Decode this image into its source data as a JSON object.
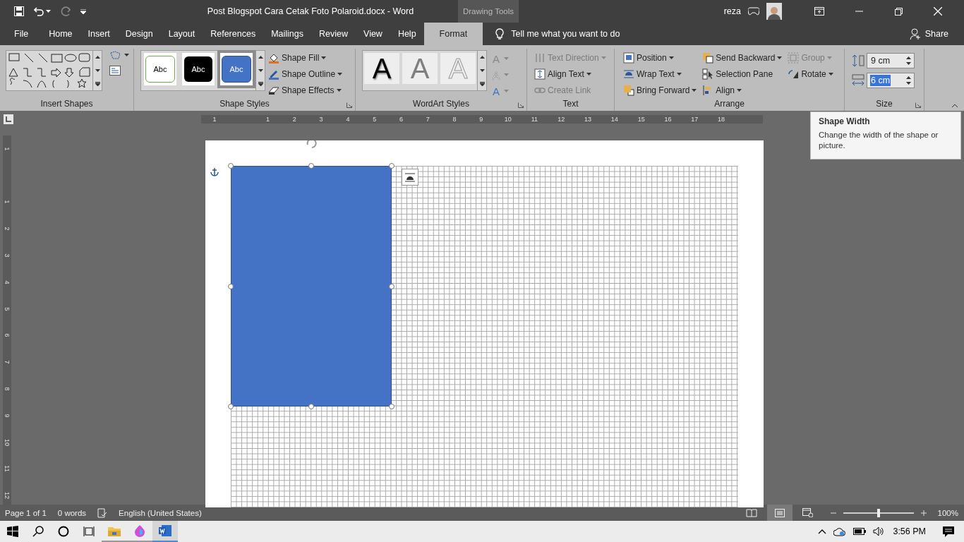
{
  "title_bar": {
    "title": "Post Blogspot Cara Cetak Foto Polaroid.docx  -  Word",
    "context_label": "Drawing Tools",
    "user": "reza",
    "redo_disabled": true
  },
  "tabs": [
    {
      "label": "File",
      "selected": false
    },
    {
      "label": "Home",
      "selected": false
    },
    {
      "label": "Insert",
      "selected": false
    },
    {
      "label": "Design",
      "selected": false
    },
    {
      "label": "Layout",
      "selected": false
    },
    {
      "label": "References",
      "selected": false
    },
    {
      "label": "Mailings",
      "selected": false
    },
    {
      "label": "Review",
      "selected": false
    },
    {
      "label": "View",
      "selected": false
    },
    {
      "label": "Help",
      "selected": false
    },
    {
      "label": "Format",
      "selected": true
    }
  ],
  "tell_me": "Tell me what you want to do",
  "share": "Share",
  "ribbon": {
    "insert_shapes": {
      "label": "Insert Shapes"
    },
    "shape_styles": {
      "label": "Shape Styles",
      "launcher": true,
      "presets": [
        {
          "text": "Abc",
          "kind": "outline",
          "selected": false
        },
        {
          "text": "Abc",
          "kind": "black",
          "selected": false
        },
        {
          "text": "Abc",
          "kind": "blue",
          "selected": true
        }
      ],
      "commands": [
        {
          "label": "Shape Fill",
          "kind": "fill"
        },
        {
          "label": "Shape Outline",
          "kind": "outline"
        },
        {
          "label": "Shape Effects",
          "kind": "effects"
        }
      ]
    },
    "wordart": {
      "label": "WordArt Styles",
      "launcher": true,
      "presets": [
        {
          "text": "A",
          "kind": "solid"
        },
        {
          "text": "A",
          "kind": "gray"
        },
        {
          "text": "A",
          "kind": "outline"
        }
      ],
      "commands": [
        {
          "text": "A",
          "kind": "fill"
        },
        {
          "text": "A",
          "kind": "outline"
        },
        {
          "text": "A",
          "kind": "effects"
        }
      ]
    },
    "text": {
      "label": "Text",
      "commands": [
        {
          "label": "Text Direction",
          "kind": "direction",
          "disabled": true,
          "dropdown": true
        },
        {
          "label": "Align Text",
          "kind": "align-text",
          "disabled": false,
          "dropdown": true
        },
        {
          "label": "Create Link",
          "kind": "link",
          "disabled": true,
          "dropdown": false
        }
      ]
    },
    "arrange": {
      "label": "Arrange",
      "columns": [
        [
          {
            "label": "Position",
            "kind": "position",
            "disabled": false,
            "dropdown": true
          },
          {
            "label": "Wrap Text",
            "kind": "wrap",
            "disabled": false,
            "dropdown": true
          },
          {
            "label": "Bring Forward",
            "kind": "forward",
            "disabled": false,
            "dropdown": true
          }
        ],
        [
          {
            "label": "Send Backward",
            "kind": "backward",
            "disabled": false,
            "dropdown": true
          },
          {
            "label": "Selection Pane",
            "kind": "pane",
            "disabled": false,
            "dropdown": false
          },
          {
            "label": "Align",
            "kind": "align",
            "disabled": false,
            "dropdown": true
          }
        ],
        [
          {
            "label": "Group",
            "kind": "group",
            "disabled": true,
            "dropdown": true
          },
          {
            "label": "Rotate",
            "kind": "rotate",
            "disabled": false,
            "dropdown": true
          }
        ]
      ]
    },
    "size": {
      "label": "Size",
      "launcher": true,
      "fields": [
        {
          "kind": "height",
          "value": "9 cm",
          "highlighted": false
        },
        {
          "kind": "width",
          "value": "6 cm",
          "highlighted": true
        }
      ]
    }
  },
  "ruler": {
    "horizontal": [
      "1",
      "1",
      "2",
      "3",
      "4",
      "5",
      "6",
      "7",
      "8",
      "9",
      "10",
      "11",
      "12",
      "13",
      "14",
      "15",
      "16",
      "17",
      "18"
    ],
    "vertical": [
      "1",
      "1",
      "2",
      "3",
      "4",
      "5",
      "6",
      "7",
      "8",
      "9",
      "10",
      "11",
      "12"
    ]
  },
  "tooltip": {
    "title": "Shape Width",
    "body": "Change the width of the shape or picture."
  },
  "status_bar": {
    "page": "Page 1 of 1",
    "words": "0 words",
    "language": "English (United States)",
    "views": [
      {
        "kind": "read",
        "selected": false
      },
      {
        "kind": "print",
        "selected": true
      },
      {
        "kind": "web",
        "selected": false
      }
    ],
    "zoom_slider": {
      "level": 0.5
    },
    "zoom": "100%"
  },
  "taskbar": {
    "apps": [
      {
        "kind": "folder",
        "active": false
      },
      {
        "kind": "paint",
        "active": false
      },
      {
        "kind": "word",
        "active": true
      }
    ],
    "time": "3:56 PM"
  }
}
